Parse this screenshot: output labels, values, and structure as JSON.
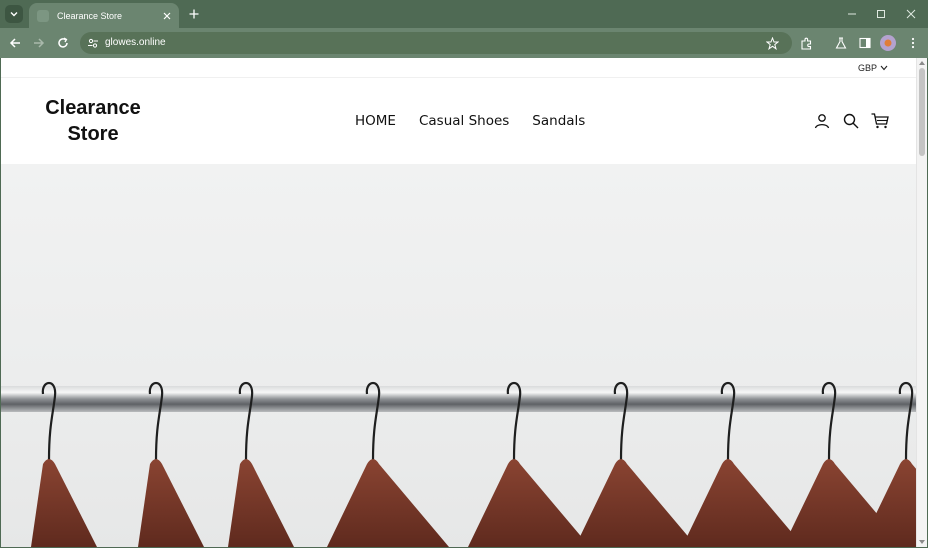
{
  "browser": {
    "tab_title": "Clearance Store",
    "url": "glowes.online"
  },
  "store": {
    "currency": "GBP",
    "logo_line1": "Clearance",
    "logo_line2": "Store",
    "nav": [
      {
        "label": "HOME"
      },
      {
        "label": "Casual Shoes"
      },
      {
        "label": "Sandals"
      }
    ]
  },
  "hero": {
    "image": "clothing-rack-with-hangers",
    "hanger_count": 9
  },
  "colors": {
    "browser_frame": "#4f6a54",
    "toolbar": "#6b8570",
    "hanger_wood": "#7a3b2b"
  }
}
